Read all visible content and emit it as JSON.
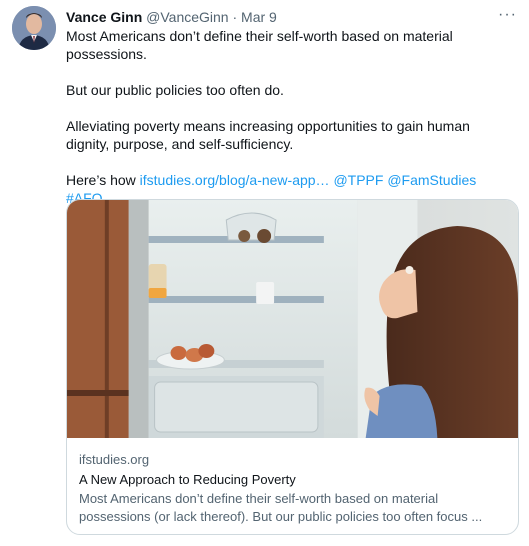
{
  "tweet": {
    "author_name": "Vance Ginn",
    "author_handle": "@VanceGinn",
    "separator": "·",
    "date": "Mar 9",
    "more": "···",
    "lines": [
      "Most Americans don’t define their self-worth based on material possessions.",
      "But our public policies too often do.",
      "Alleviating poverty means increasing opportunities to gain human dignity, purpose, and self-sufficiency."
    ],
    "here_prefix": "Here’s how ",
    "url": "ifstudies.org/blog/a-new-app…",
    "mention1": "@TPPF",
    "mention2": "@FamStudies",
    "hashtag": "#AFO"
  },
  "card": {
    "domain": "ifstudies.org",
    "title": "A New Approach to Reducing Poverty",
    "description": "Most Americans don’t define their self-worth based on material possessions (or lack thereof). But our public policies too often focus ...",
    "image": "girl-looking-in-empty-fridge"
  },
  "colors": {
    "link": "#1d9bf0",
    "secondary_text": "#536471",
    "border": "#cfd9de"
  }
}
